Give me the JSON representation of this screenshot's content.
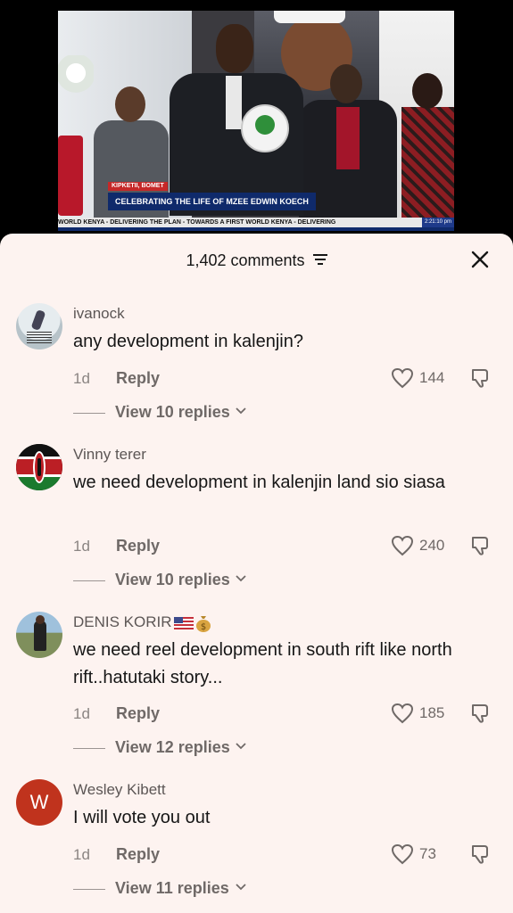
{
  "video": {
    "location": "KIPKETII, BOMET",
    "headline": "CELEBRATING THE LIFE OF MZEE EDWIN KOECH",
    "ticker": "WORLD KENYA - DELIVERING THE PLAN - TOWARDS A FIRST WORLD KENYA - DELIVERING",
    "time": "2:21:10 pm"
  },
  "sheet": {
    "comment_count": "1,402 comments",
    "close_icon": "close-icon",
    "filter_icon": "filter-icon"
  },
  "comments": [
    {
      "user": "ivanock",
      "text": "any development in kalenjin?",
      "time": "1d",
      "reply": "Reply",
      "likes": "144",
      "view_replies": "View 10 replies"
    },
    {
      "user": "Vinny terer",
      "text": "we need development in kalenjin land sio siasa",
      "time": "1d",
      "reply": "Reply",
      "likes": "240",
      "view_replies": "View 10 replies"
    },
    {
      "user": "DENIS KORIR",
      "user_badges": [
        "us-flag-icon",
        "money-bag-icon"
      ],
      "text": "we need reel development in south rift like north rift..hatutaki story...",
      "time": "1d",
      "reply": "Reply",
      "likes": "185",
      "view_replies": "View 12 replies"
    },
    {
      "user": "Wesley Kibett",
      "avatar_letter": "W",
      "text": "I will vote you out",
      "time": "1d",
      "reply": "Reply",
      "likes": "73",
      "view_replies": "View 11 replies"
    }
  ],
  "colors": {
    "sheet_bg": "#fdf3f0",
    "text_primary": "#161616",
    "text_secondary": "#6f6967",
    "avatar_w": "#c0331d"
  }
}
